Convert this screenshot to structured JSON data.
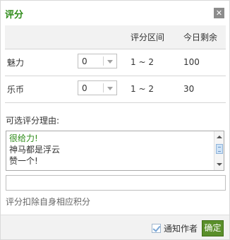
{
  "dialog": {
    "title": "评分",
    "close_glyph": "✕"
  },
  "table": {
    "headers": [
      "",
      "",
      "评分区间",
      "今日剩余"
    ],
    "rows": [
      {
        "name": "魅力",
        "selected": "0",
        "range": "1 ~ 2",
        "remaining": "100"
      },
      {
        "name": "乐币",
        "selected": "0",
        "range": "1 ~ 2",
        "remaining": "30"
      }
    ]
  },
  "reasons": {
    "label": "可选评分理由:",
    "items": [
      "很给力!",
      "神马都是浮云",
      "赞一个!"
    ],
    "input_value": ""
  },
  "note": "评分扣除自身相应积分",
  "footer": {
    "notify_label": "通知作者",
    "notify_checked": true,
    "confirm_label": "确定"
  },
  "colors": {
    "accent_green": "#2e8b18",
    "button_green": "#5a8f2b"
  },
  "icons": {
    "close": "close-icon",
    "dropdown": "chevron-down-icon",
    "scroll_up": "arrow-up-icon",
    "scroll_down": "arrow-down-icon"
  }
}
